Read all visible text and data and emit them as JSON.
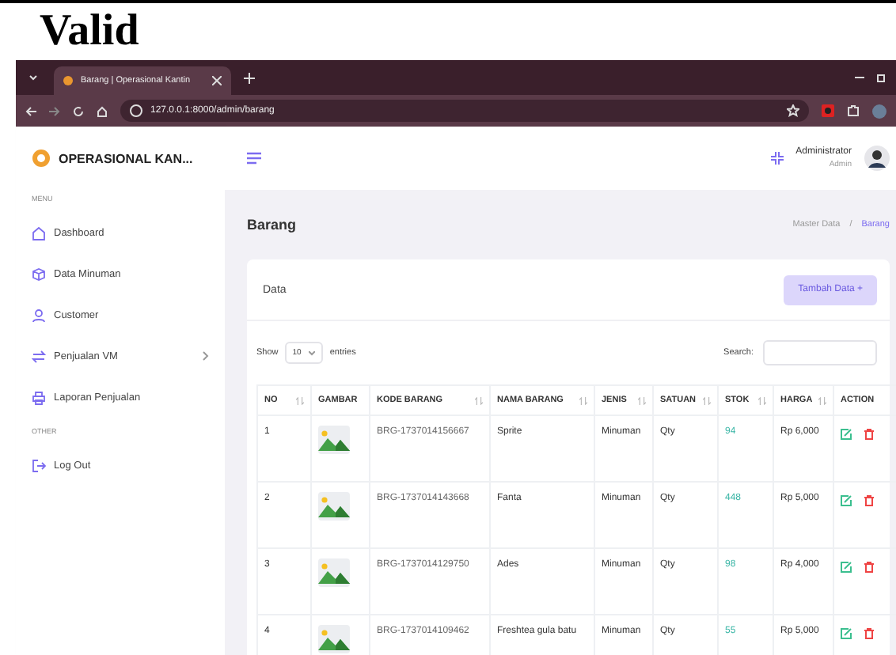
{
  "heading": "Valid",
  "browser": {
    "tab_title": "Barang | Operasional Kantin",
    "url": "127.0.0.1:8000/admin/barang"
  },
  "app": {
    "brand": "OPERASIONAL KAN...",
    "user": {
      "name": "Administrator",
      "role": "Admin"
    }
  },
  "sidebar": {
    "sections": [
      {
        "label": "MENU",
        "items": [
          {
            "label": "Dashboard",
            "kind": "home",
            "has_submenu": false
          },
          {
            "label": "Data Minuman",
            "kind": "box",
            "has_submenu": false
          },
          {
            "label": "Customer",
            "kind": "user",
            "has_submenu": false
          },
          {
            "label": "Penjualan VM",
            "kind": "swap",
            "has_submenu": true
          },
          {
            "label": "Laporan Penjualan",
            "kind": "printer",
            "has_submenu": false
          }
        ]
      },
      {
        "label": "OTHER",
        "items": [
          {
            "label": "Log Out",
            "kind": "logout",
            "has_submenu": false
          }
        ]
      }
    ]
  },
  "page": {
    "title": "Barang",
    "breadcrumb": [
      "Master Data",
      "Barang"
    ],
    "breadcrumb_separator": "/"
  },
  "card": {
    "title": "Data",
    "add_button": "Tambah Data +",
    "show_label": "Show",
    "entries_value": "10",
    "entries_label": "entries",
    "search_label": "Search:"
  },
  "table": {
    "columns": [
      {
        "label": "NO",
        "sortable": true
      },
      {
        "label": "GAMBAR",
        "sortable": false
      },
      {
        "label": "KODE BARANG",
        "sortable": true
      },
      {
        "label": "NAMA BARANG",
        "sortable": true
      },
      {
        "label": "JENIS",
        "sortable": true
      },
      {
        "label": "SATUAN",
        "sortable": true
      },
      {
        "label": "STOK",
        "sortable": true
      },
      {
        "label": "HARGA",
        "sortable": true
      },
      {
        "label": "ACTION",
        "sortable": false
      }
    ],
    "rows": [
      {
        "no": "1",
        "kode": "BRG-1737014156667",
        "nama": "Sprite",
        "jenis": "Minuman",
        "satuan": "Qty",
        "stok": "94",
        "harga": "Rp 6,000"
      },
      {
        "no": "2",
        "kode": "BRG-1737014143668",
        "nama": "Fanta",
        "jenis": "Minuman",
        "satuan": "Qty",
        "stok": "448",
        "harga": "Rp 5,000"
      },
      {
        "no": "3",
        "kode": "BRG-1737014129750",
        "nama": "Ades",
        "jenis": "Minuman",
        "satuan": "Qty",
        "stok": "98",
        "harga": "Rp 4,000"
      },
      {
        "no": "4",
        "kode": "BRG-1737014109462",
        "nama": "Freshtea gula batu",
        "jenis": "Minuman",
        "satuan": "Qty",
        "stok": "55",
        "harga": "Rp 5,000"
      }
    ]
  }
}
